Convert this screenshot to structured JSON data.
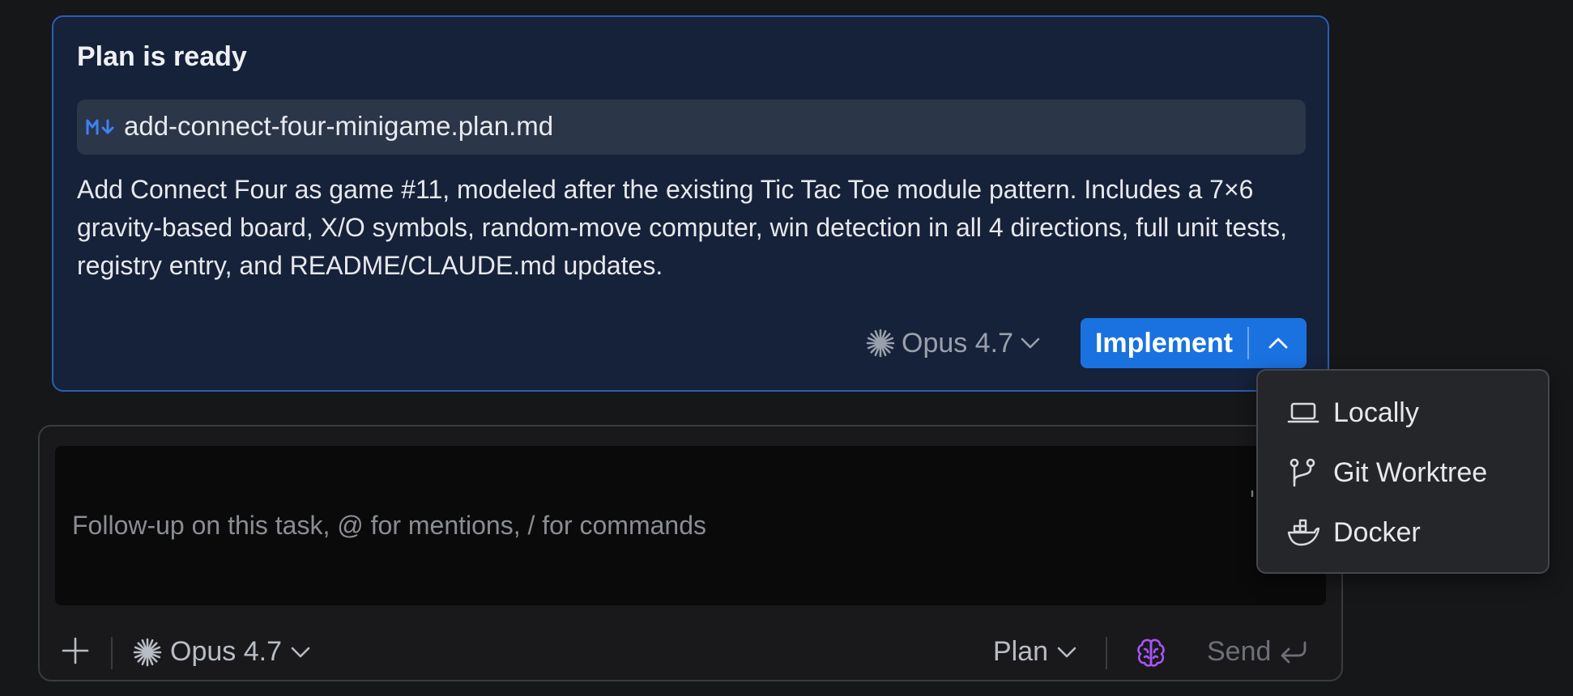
{
  "plan_card": {
    "title": "Plan is ready",
    "file_badge": "M↓",
    "file_name": "add-connect-four-minigame.plan.md",
    "description": "Add Connect Four as game #11, modeled after the existing Tic Tac Toe module pattern. Includes a 7×6 gravity-based board, X/O symbols, random-move computer, win detection in all 4 directions, full unit tests, registry entry, and README/CLAUDE.md updates.",
    "model_label": "Opus 4.7",
    "implement_label": "Implement"
  },
  "dropdown": {
    "items": [
      {
        "label": "Locally",
        "icon": "laptop-icon"
      },
      {
        "label": "Git Worktree",
        "icon": "git-branch-icon"
      },
      {
        "label": "Docker",
        "icon": "docker-icon"
      }
    ]
  },
  "composer": {
    "placeholder": "Follow-up on this task, @ for mentions, / for commands",
    "model_label": "Opus 4.7",
    "mode_label": "Plan",
    "send_label": "Send"
  },
  "colors": {
    "accent": "#1a72e0",
    "card_background": "#16213a",
    "card_border": "#2b5db6",
    "brain_icon": "#a855f7"
  }
}
